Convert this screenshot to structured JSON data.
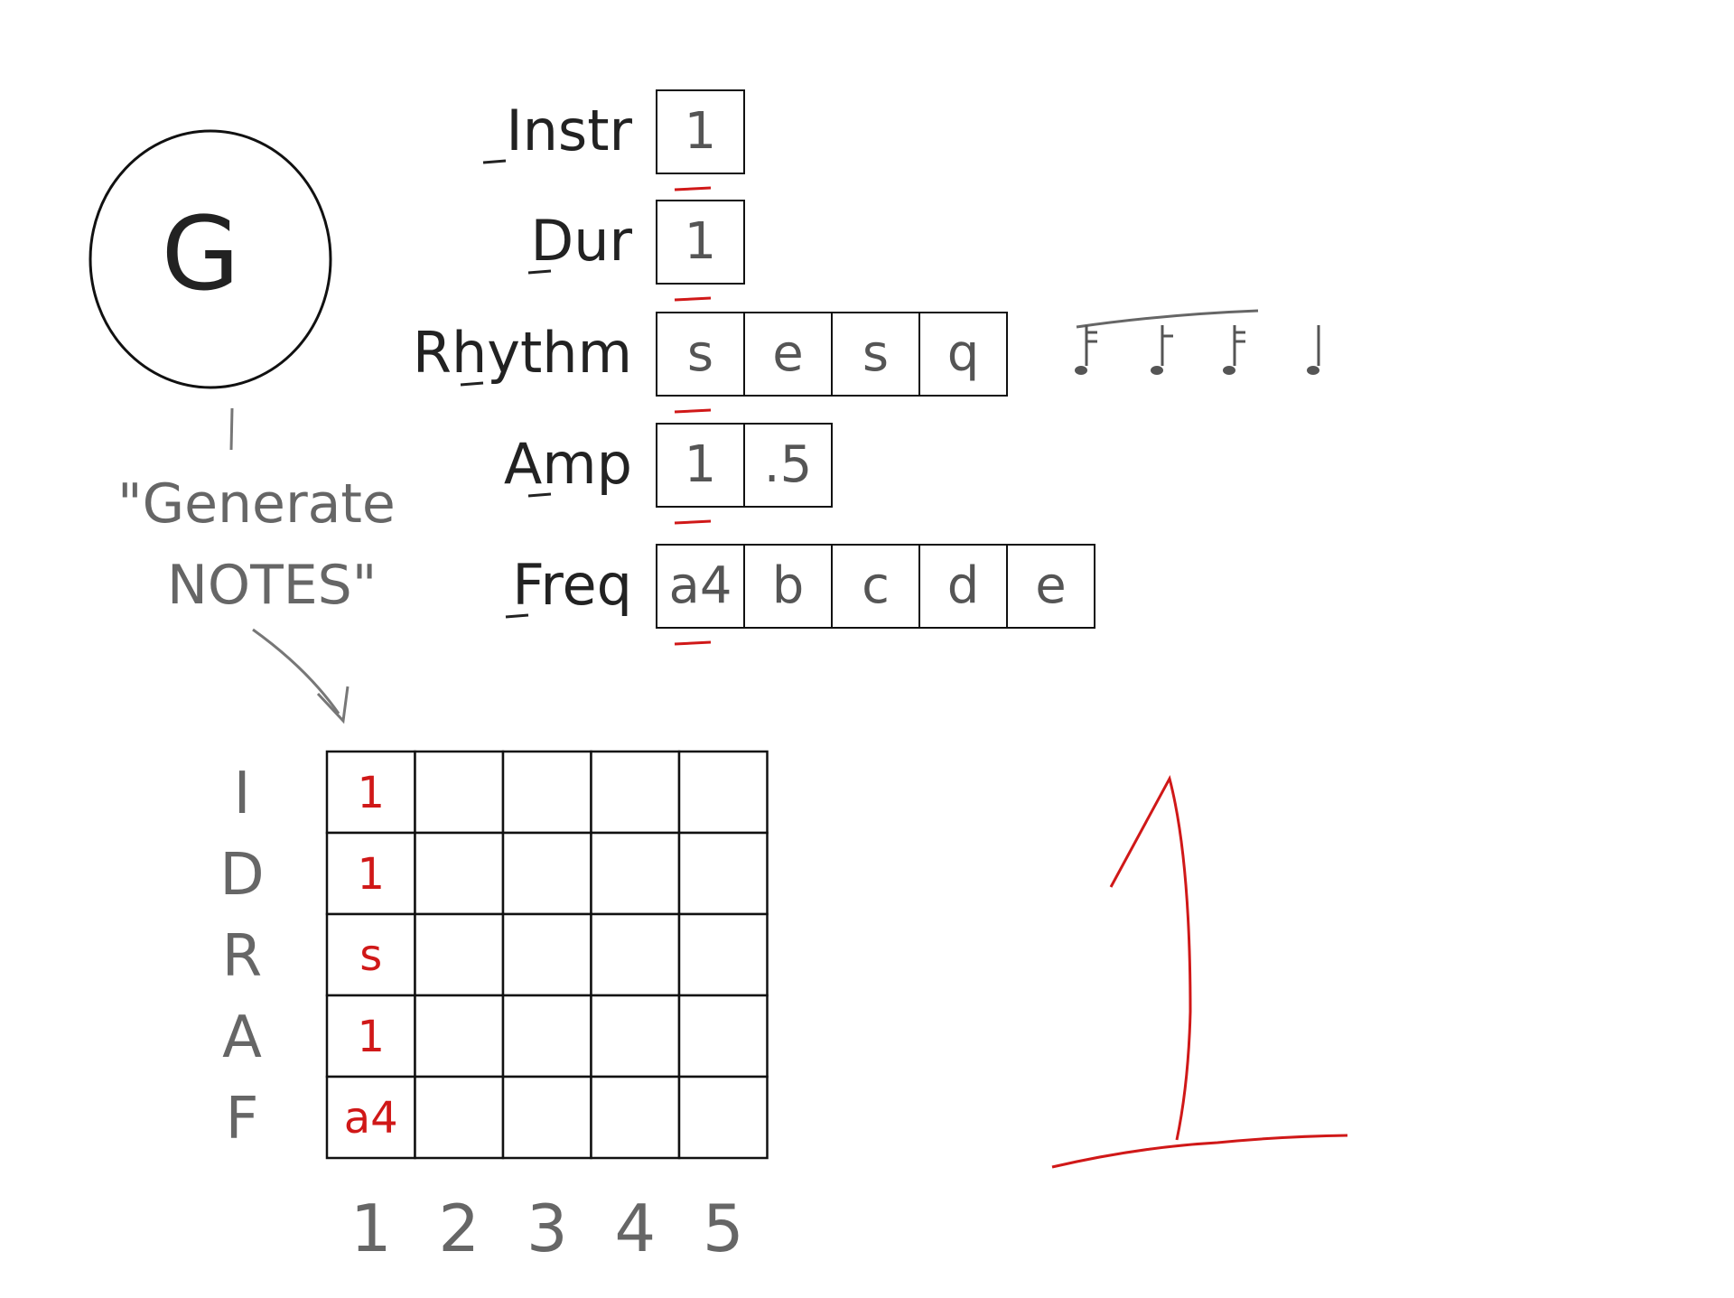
{
  "generate": {
    "circle_letter": "G",
    "caption_line1": "\"Generate",
    "caption_line2": "NOTES\""
  },
  "params": [
    {
      "label": "Instr",
      "values": [
        "1"
      ],
      "selected": 0
    },
    {
      "label": "Dur",
      "values": [
        "1"
      ],
      "selected": 0
    },
    {
      "label": "Rhythm",
      "values": [
        "s",
        "e",
        "s",
        "q"
      ],
      "selected": 0
    },
    {
      "label": "Amp",
      "values": [
        "1",
        ".5"
      ],
      "selected": 0
    },
    {
      "label": "Freq",
      "values": [
        "a4",
        "b",
        "c",
        "d",
        "e"
      ],
      "selected": 0
    }
  ],
  "rhythm_notation": [
    "sixteenth-note",
    "eighth-note",
    "sixteenth-note",
    "quarter-note"
  ],
  "grid": {
    "row_labels": [
      "I",
      "D",
      "R",
      "A",
      "F"
    ],
    "col_labels": [
      "1",
      "2",
      "3",
      "4",
      "5"
    ],
    "first_column": [
      "1",
      "1",
      "s",
      "1",
      "a4"
    ]
  },
  "big_number": "1",
  "colors": {
    "ink": "#222222",
    "pencil": "#666666",
    "highlight": "#d01818"
  }
}
